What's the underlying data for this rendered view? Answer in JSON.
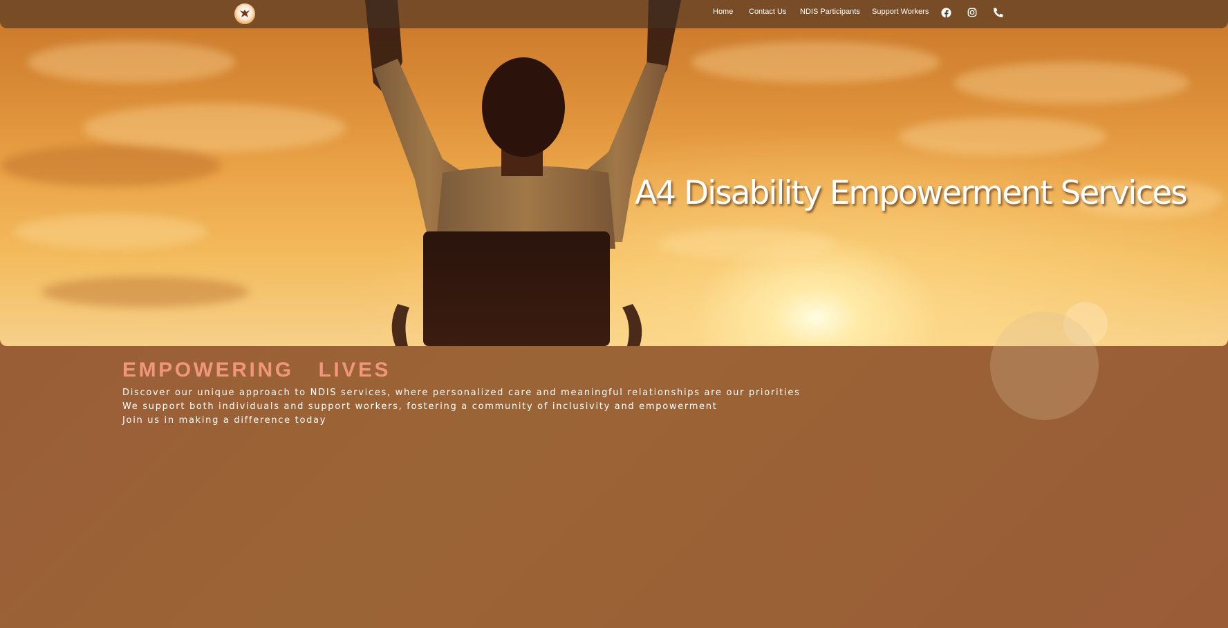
{
  "nav": {
    "logo_icon": "eagle-logo-icon",
    "links": [
      {
        "label": "Home"
      },
      {
        "label": "Contact Us"
      },
      {
        "label": "NDIS Participants"
      },
      {
        "label": "Support Workers"
      }
    ],
    "social_icons": [
      "facebook-icon",
      "instagram-icon",
      "phone-icon"
    ]
  },
  "hero": {
    "title": "A4 Disability Empowerment Services"
  },
  "intro": {
    "heading": "EMPOWERING   LIVES",
    "lines": [
      "Discover our unique approach to NDIS services, where personalized care and meaningful relationships are our priorities",
      "We support both individuals and support workers, fostering a community of inclusivity and empowerment",
      "Join us in making a difference today"
    ]
  },
  "colors": {
    "heading_accent": "#f0967a",
    "background": "#9a5e37",
    "hero_sky": "#eba448",
    "navbar": "#463223"
  }
}
